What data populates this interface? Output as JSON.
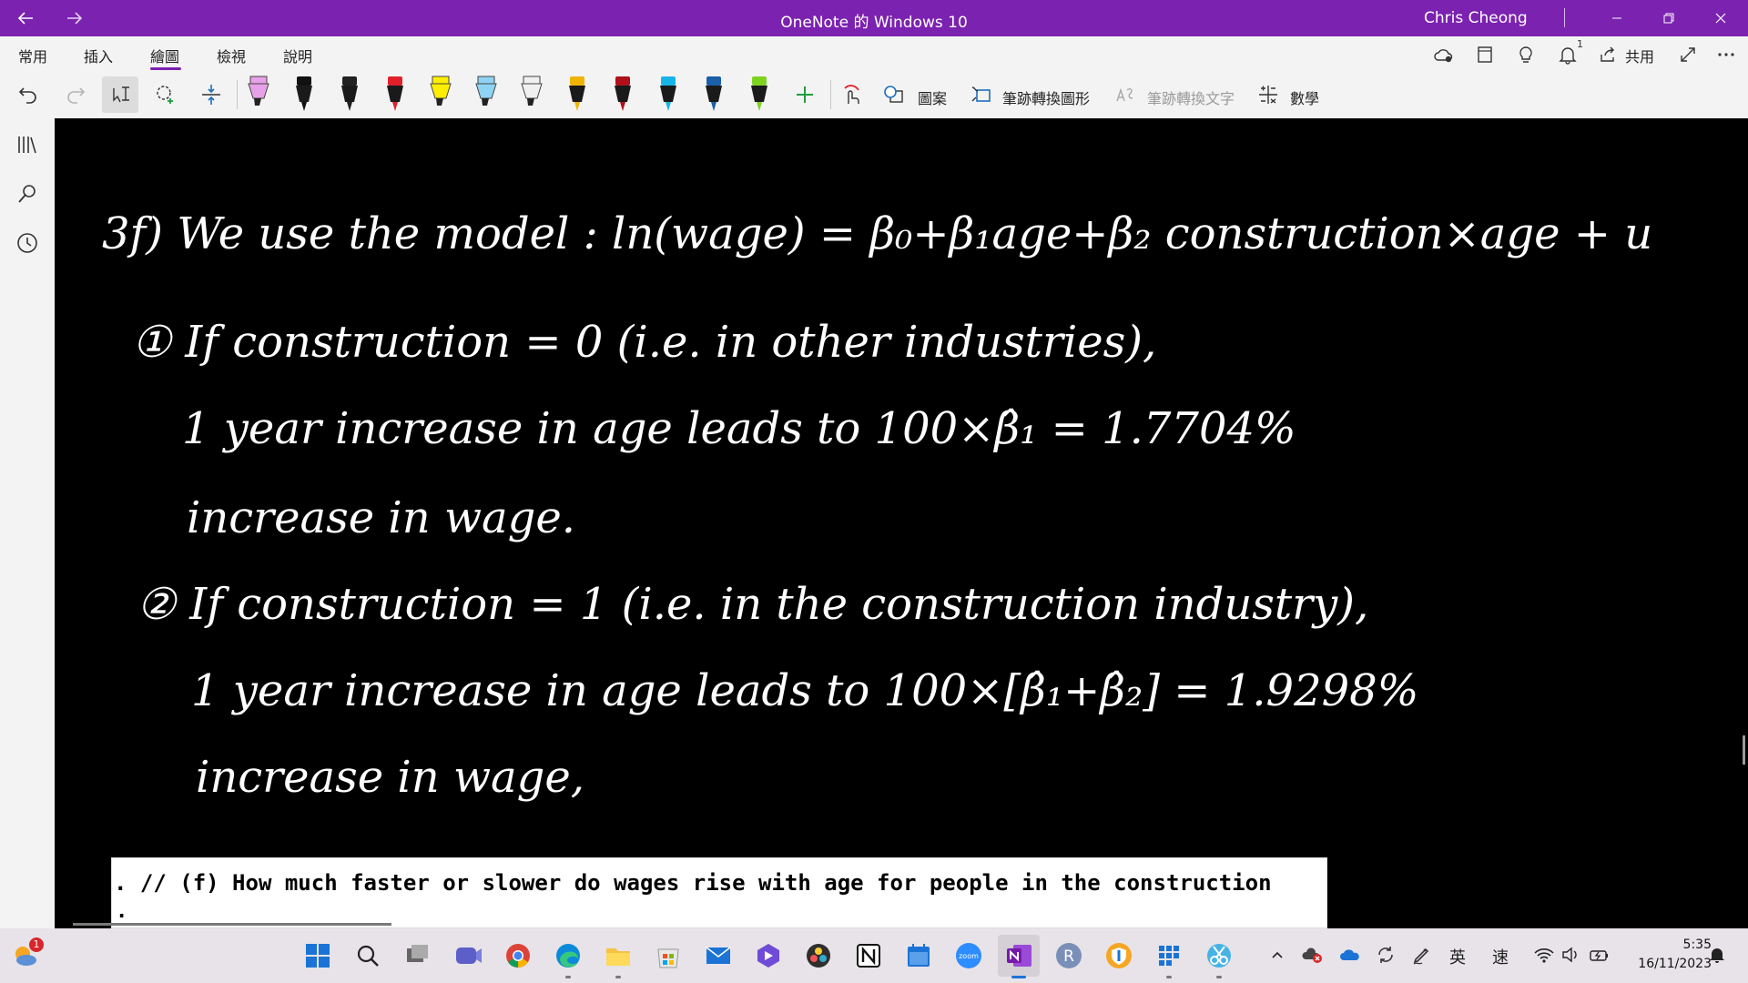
{
  "window": {
    "title": "OneNote 的 Windows 10",
    "user": "Chris Cheong"
  },
  "menu": {
    "tabs": [
      "常用",
      "插入",
      "繪圖",
      "檢視",
      "說明"
    ],
    "active_tab": "繪圖",
    "share_label": "共用",
    "notification_count": "1"
  },
  "toolbar": {
    "shapes_label": "圖案",
    "ink_to_shape_label": "筆跡轉換圖形",
    "ink_to_text_label": "筆跡轉換文字",
    "math_label": "數學",
    "pens": [
      {
        "name": "pen-pink-highlighter",
        "color": "#e7a1e8",
        "tip": "#111111"
      },
      {
        "name": "pen-black-1",
        "color": "#111111",
        "tip": "#111111"
      },
      {
        "name": "pen-black-2",
        "color": "#222222",
        "tip": "#111111"
      },
      {
        "name": "pen-red",
        "color": "#e0202a",
        "tip": "#111111"
      },
      {
        "name": "pen-yellow-highlighter",
        "color": "#ffee00",
        "tip": "#111111"
      },
      {
        "name": "pen-lightblue-highlighter",
        "color": "#8fd3f4",
        "tip": "#111111"
      },
      {
        "name": "pen-white-highlighter",
        "color": "#f0f0f0",
        "tip": "#111111"
      },
      {
        "name": "pen-gold",
        "color": "#f0b400",
        "tip": "#111111"
      },
      {
        "name": "pen-darkred",
        "color": "#b0101a",
        "tip": "#111111"
      },
      {
        "name": "pen-cyan",
        "color": "#18b4e8",
        "tip": "#111111"
      },
      {
        "name": "pen-navy",
        "color": "#1a5fa8",
        "tip": "#111111"
      },
      {
        "name": "pen-green",
        "color": "#7ed321",
        "tip": "#111111"
      }
    ]
  },
  "ink_lines": [
    "3f) We use the model : ln(wage) = β₀+β₁age+β₂ construction×age + u",
    "① If construction = 0 (i.e. in other industries),",
    "1 year increase in age leads to 100×β̂₁ = 1.7704%",
    "increase in wage.",
    "② If construction = 1 (i.e. in the construction industry),",
    "1 year increase in age leads to 100×[β̂₁+β̂₂] = 1.9298%",
    "increase in wage,"
  ],
  "code_snippet": {
    "line": ". // (f) How much faster or slower do wages rise with age for people in the construction",
    "second_line": "."
  },
  "taskbar": {
    "start_badge": "1",
    "ime_lang": "英",
    "ime_mode": "速",
    "time": "5:35",
    "date": "16/11/2023"
  },
  "colors": {
    "accent": "#7b22b0",
    "chrome": "#f3f3f3",
    "canvas": "#000000"
  }
}
